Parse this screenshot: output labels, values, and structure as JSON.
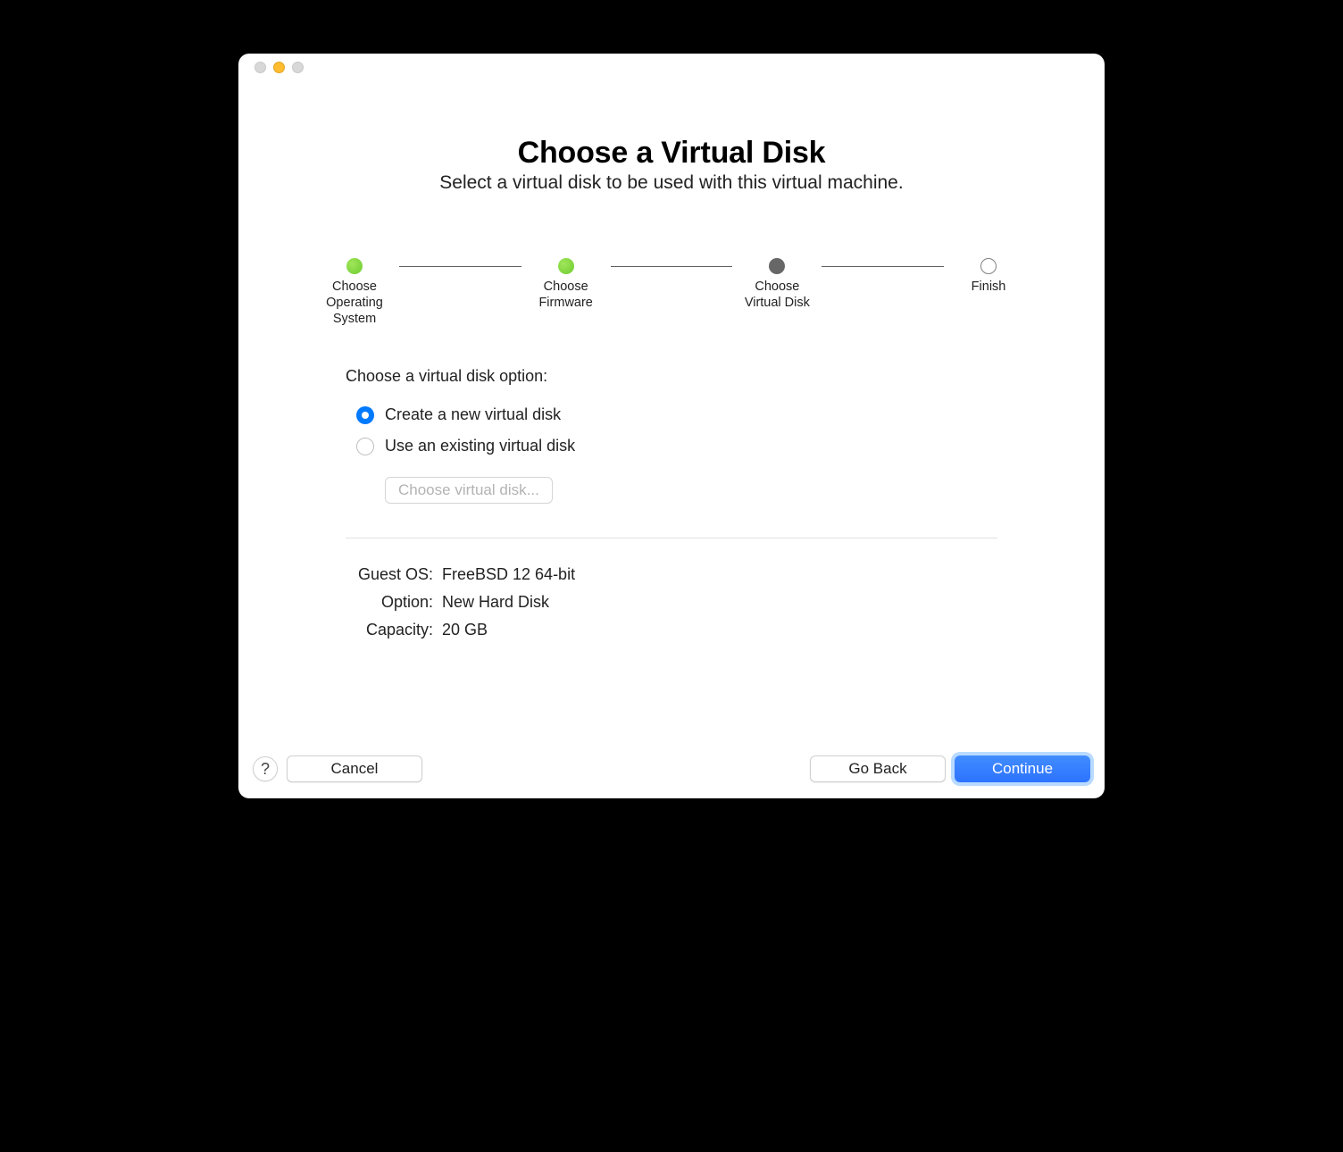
{
  "header": {
    "title": "Choose a Virtual Disk",
    "subtitle": "Select a virtual disk to be used with this virtual machine."
  },
  "steps": [
    {
      "label": "Choose\nOperating\nSystem",
      "state": "done"
    },
    {
      "label": "Choose\nFirmware",
      "state": "done"
    },
    {
      "label": "Choose\nVirtual Disk",
      "state": "current"
    },
    {
      "label": "Finish",
      "state": "future"
    }
  ],
  "section_label": "Choose a virtual disk option:",
  "options": {
    "create": "Create a new virtual disk",
    "existing": "Use an existing virtual disk",
    "selected": "create",
    "choose_button": "Choose virtual disk..."
  },
  "summary": {
    "guest_os_label": "Guest OS:",
    "guest_os_value": "FreeBSD 12 64-bit",
    "option_label": "Option:",
    "option_value": "New Hard Disk",
    "capacity_label": "Capacity:",
    "capacity_value": "20 GB"
  },
  "footer": {
    "help": "?",
    "cancel": "Cancel",
    "go_back": "Go Back",
    "continue": "Continue"
  }
}
